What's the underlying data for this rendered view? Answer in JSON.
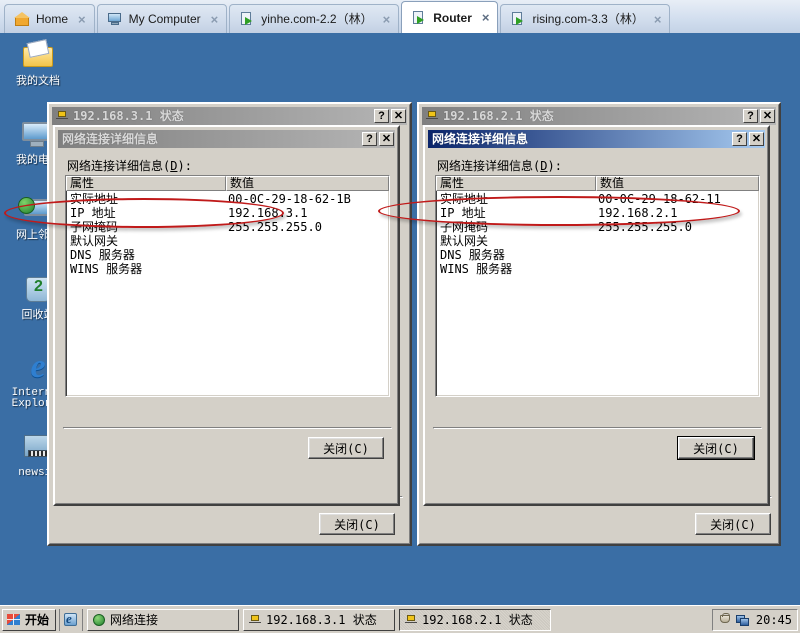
{
  "app": {
    "tabs": [
      {
        "label": "Home",
        "icon": "home-icon",
        "active": false,
        "closable": true
      },
      {
        "label": "My Computer",
        "icon": "monitor-icon",
        "active": false,
        "closable": true
      },
      {
        "label": "yinhe.com-2.2（林）",
        "icon": "vm-running-icon",
        "active": false,
        "closable": true
      },
      {
        "label": "Router",
        "icon": "vm-running-icon",
        "active": true,
        "closable": true
      },
      {
        "label": "rising.com-3.3（林）",
        "icon": "vm-running-icon",
        "active": false,
        "closable": true
      }
    ],
    "tab_close_glyph": "×"
  },
  "desktop": {
    "icons": [
      {
        "name": "my-documents",
        "label": "我的文档",
        "glyph": "documents-folder-icon"
      },
      {
        "name": "my-computer",
        "label": "我的电脑",
        "glyph": "my-computer-icon"
      },
      {
        "name": "network-neighborhood",
        "label": "网上邻居",
        "glyph": "network-places-icon"
      },
      {
        "name": "recycle-bin",
        "label": "回收站",
        "glyph": "recycle-bin-icon"
      },
      {
        "name": "internet-explorer",
        "label": "Internet Explorer",
        "glyph": "internet-explorer-icon"
      },
      {
        "name": "newsid",
        "label": "newsid",
        "glyph": "newsid-icon"
      }
    ]
  },
  "windows": [
    {
      "id": "left",
      "outer_title": "192.168.3.1 状态",
      "outer_active": false,
      "inner_title": "网络连接详细信息",
      "inner_active": false,
      "help_label": "?",
      "close_label": "×",
      "details_label": "网络连接详细信息(D):",
      "details_label_pre": "网络连接详细信息(",
      "details_accel": "D",
      "details_label_post": "):",
      "columns": [
        "属性",
        "数值"
      ],
      "rows": [
        {
          "property": "实际地址",
          "value": "00-0C-29-18-62-1B"
        },
        {
          "property": "IP 地址",
          "value": "192.168.3.1"
        },
        {
          "property": "子网掩码",
          "value": "255.255.255.0"
        },
        {
          "property": "默认网关",
          "value": ""
        },
        {
          "property": "DNS 服务器",
          "value": ""
        },
        {
          "property": "WINS 服务器",
          "value": ""
        }
      ],
      "inner_close_button": "关闭(C)",
      "outer_close_button": "关闭(C)"
    },
    {
      "id": "right",
      "outer_title": "192.168.2.1 状态",
      "outer_active": false,
      "inner_title": "网络连接详细信息",
      "inner_active": true,
      "help_label": "?",
      "close_label": "×",
      "details_label": "网络连接详细信息(D):",
      "details_label_pre": "网络连接详细信息(",
      "details_accel": "D",
      "details_label_post": "):",
      "columns": [
        "属性",
        "数值"
      ],
      "rows": [
        {
          "property": "实际地址",
          "value": "00-0C-29-18-62-11"
        },
        {
          "property": "IP 地址",
          "value": "192.168.2.1"
        },
        {
          "property": "子网掩码",
          "value": "255.255.255.0"
        },
        {
          "property": "默认网关",
          "value": ""
        },
        {
          "property": "DNS 服务器",
          "value": ""
        },
        {
          "property": "WINS 服务器",
          "value": ""
        }
      ],
      "inner_close_button": "关闭(C)",
      "outer_close_button": "关闭(C)"
    }
  ],
  "annotations": {
    "color": "#c01a1a",
    "marks": [
      {
        "target": "left IP 地址 row",
        "shape": "ellipse"
      },
      {
        "target": "right IP 地址 row",
        "shape": "ellipse"
      }
    ]
  },
  "taskbar": {
    "start_label": "开始",
    "quick_launch": [
      {
        "name": "ie-quick-launch",
        "icon": "ie-icon"
      }
    ],
    "items": [
      {
        "label": "网络连接",
        "icon": "globe-icon",
        "pressed": false
      },
      {
        "label": "192.168.3.1 状态",
        "icon": "net-status-icon",
        "pressed": false
      },
      {
        "label": "192.168.2.1 状态",
        "icon": "net-status-icon",
        "pressed": true
      }
    ],
    "tray_icons": [
      "shield-icon",
      "network-pair-icon"
    ],
    "clock": "20:45"
  }
}
